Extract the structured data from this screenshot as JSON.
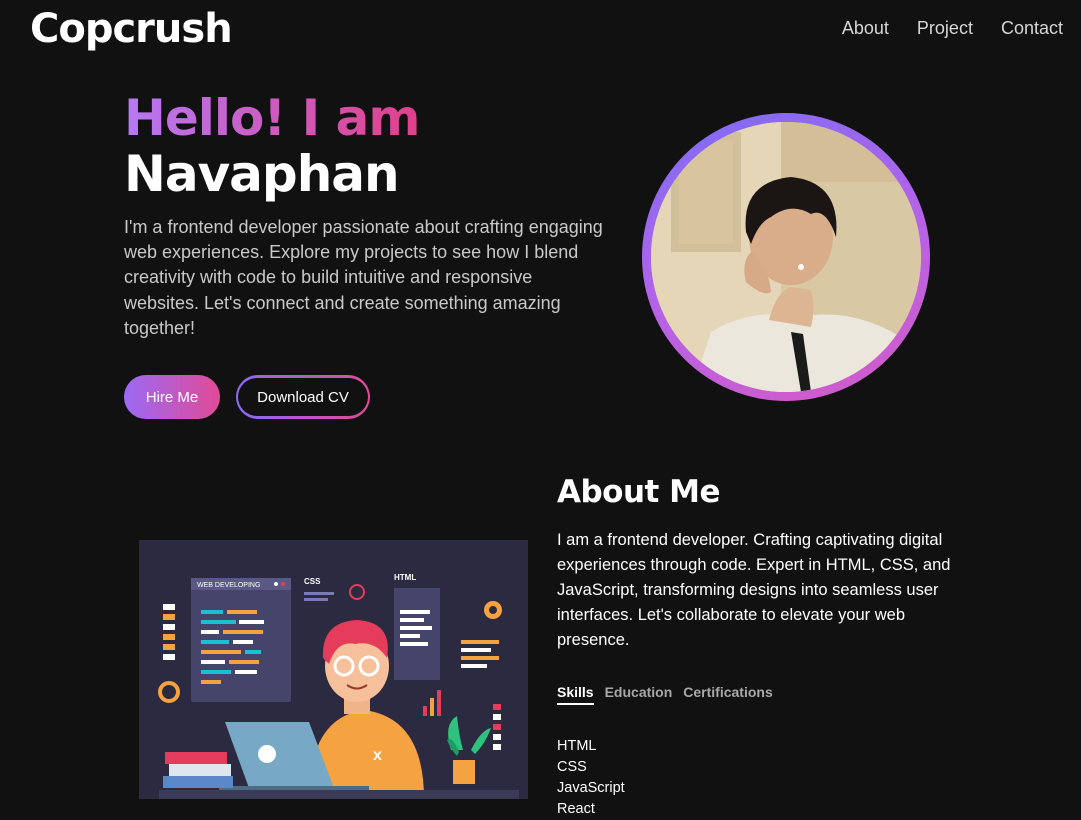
{
  "header": {
    "brand": "Copcrush",
    "nav": [
      {
        "label": "About"
      },
      {
        "label": "Project"
      },
      {
        "label": "Contact"
      }
    ]
  },
  "hero": {
    "greeting": "Hello! I am",
    "name": "Navaphan",
    "intro": "I'm a frontend developer passionate about crafting engaging web experiences. Explore my projects to see how I blend creativity with code to build intuitive and responsive websites. Let's connect and create something amazing together!",
    "hire_label": "Hire Me",
    "cv_label": "Download CV"
  },
  "illustration": {
    "panel_title": "WEB DEVELOPING",
    "css_label": "CSS",
    "html_label": "HTML"
  },
  "about": {
    "title": "About Me",
    "text": "I am a frontend developer. Crafting captivating digital experiences through code. Expert in HTML, CSS, and JavaScript, transforming designs into seamless user interfaces. Let's collaborate to elevate your web presence.",
    "tabs": [
      {
        "label": "Skills",
        "active": true
      },
      {
        "label": "Education",
        "active": false
      },
      {
        "label": "Certifications",
        "active": false
      }
    ],
    "skills": [
      "HTML",
      "CSS",
      "JavaScript",
      "React"
    ]
  },
  "colors": {
    "background": "#121112",
    "gradient_start": "#b679f5",
    "gradient_end": "#e2408a"
  }
}
